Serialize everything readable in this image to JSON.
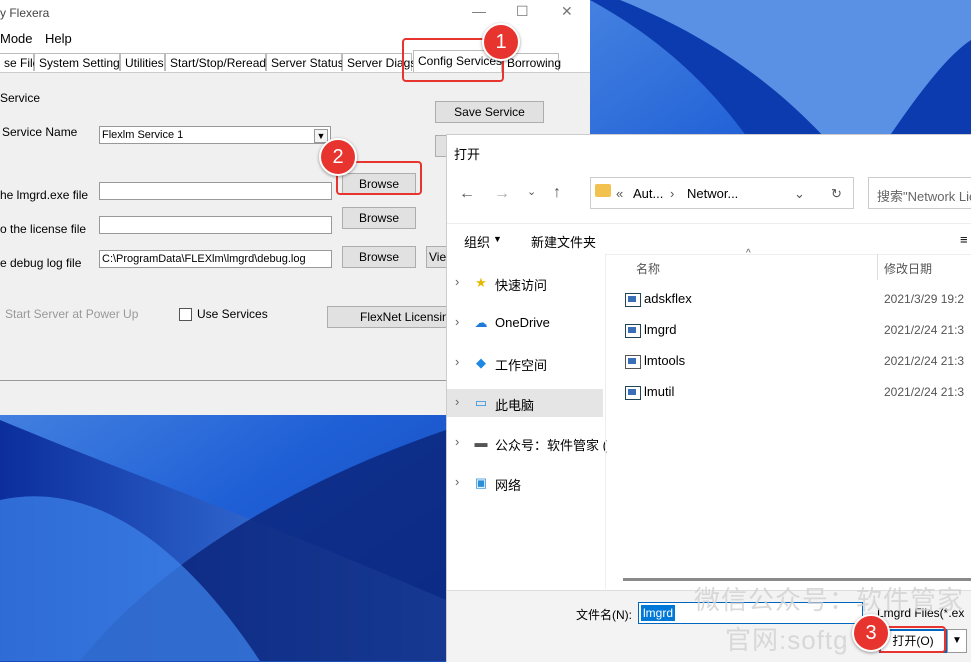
{
  "lmtools": {
    "title": "y Flexera",
    "menu": [
      "Mode",
      "Help"
    ],
    "tabs": [
      "se File",
      "System Settings",
      "Utilities",
      "Start/Stop/Reread",
      "Server Status",
      "Server Diags",
      "Config Services",
      "Borrowing"
    ],
    "active_tab": "Config Services",
    "service_section": "Service",
    "service_name_label": "Service Name",
    "service_name_value": "Flexlm Service 1",
    "save_service": "Save Service",
    "lmgrd_label": "he lmgrd.exe file",
    "lmgrd_value": "",
    "license_label": "o the license file",
    "license_value": "",
    "debug_label": "e debug log file",
    "debug_value": "C:\\ProgramData\\FLEXlm\\lmgrd\\debug.log",
    "browse": "Browse",
    "view": "View",
    "start_at_powerup": "Start Server at Power Up",
    "use_services": "Use Services",
    "flexnet_licensing": "FlexNet Licensing"
  },
  "dialog": {
    "title": "打开",
    "address": {
      "sep": "«",
      "crumb1": "Aut...",
      "crumb2": "Networ..."
    },
    "search_placeholder": "搜索\"Network Lic",
    "organize": "组织",
    "new_folder": "新建文件夹",
    "nav": [
      "快速访问",
      "OneDrive",
      "工作空间",
      "此电脑",
      "公众号：软件管家 (",
      "网络"
    ],
    "selected_nav": "此电脑",
    "col_name": "名称",
    "col_modified": "修改日期",
    "files": [
      {
        "name": "adskflex",
        "date": "2021/3/29 19:2"
      },
      {
        "name": "lmgrd",
        "date": "2021/2/24 21:3"
      },
      {
        "name": "lmtools",
        "date": "2021/2/24 21:3"
      },
      {
        "name": "lmutil",
        "date": "2021/2/24 21:3"
      }
    ],
    "filename_label": "文件名(N):",
    "filename_value": "lmgrd",
    "filetype": "Lmgrd Files(*.ex",
    "open": "打开(O)"
  },
  "callouts": [
    "1",
    "2",
    "3"
  ],
  "watermark": {
    "line1": "微信公众号：软件管家",
    "line2": "官网:softg"
  },
  "colors": {
    "callout": "#e8342e",
    "accent": "#0078d7",
    "wallpaper": "#1a4bb8"
  }
}
